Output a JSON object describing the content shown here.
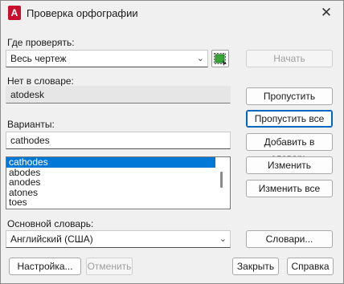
{
  "window": {
    "title": "Проверка орфографии",
    "app_icon_letter": "A",
    "close_glyph": "✕"
  },
  "where_to_check": {
    "label": "Где проверять:",
    "value": "Весь чертеж",
    "start_button": "Начать"
  },
  "not_in_dictionary": {
    "label": "Нет в словаре:",
    "value": "atodesk"
  },
  "suggestions": {
    "label": "Варианты:",
    "value": "cathodes",
    "list": [
      "cathodes",
      "abodes",
      "anodes",
      "atones",
      "toes"
    ],
    "selected_index": 0
  },
  "main_dictionary": {
    "label": "Основной словарь:",
    "value": "Английский (США)",
    "dictionaries_button": "Словари..."
  },
  "actions": {
    "ignore": "Пропустить",
    "ignore_all": "Пропустить все",
    "add_to_dictionary": "Добавить в словарь",
    "change": "Изменить",
    "change_all": "Изменить все"
  },
  "footer": {
    "settings": "Настройка...",
    "undo": "Отменить",
    "close": "Закрыть",
    "help": "Справка"
  },
  "colors": {
    "accent": "#0078d7",
    "app_icon": "#c8102e",
    "select_icon_green": "#2e8b2e"
  }
}
